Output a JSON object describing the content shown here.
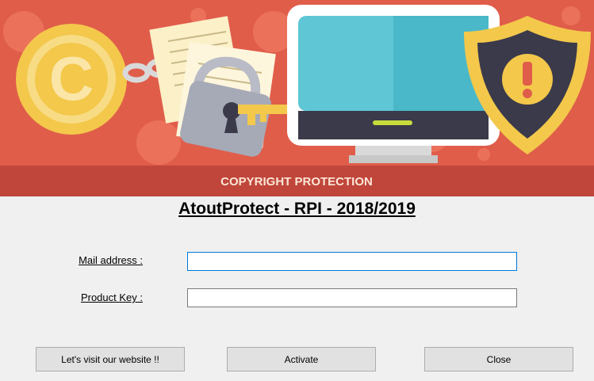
{
  "banner": {
    "caption": "COPYRIGHT PROTECTION"
  },
  "app": {
    "title": "AtoutProtect - RPI - 2018/2019"
  },
  "form": {
    "mail_label": "Mail address :",
    "mail_value": "",
    "key_label": "Product Key :",
    "key_value": ""
  },
  "buttons": {
    "website": "Let's visit our website !!",
    "activate": "Activate",
    "close": "Close"
  },
  "colors": {
    "banner_bg": "#e05d4a",
    "banner_strip": "#c0463b",
    "gold": "#f3c84b",
    "screen": "#5fc6d6",
    "window_bg": "#f0f0f0"
  }
}
